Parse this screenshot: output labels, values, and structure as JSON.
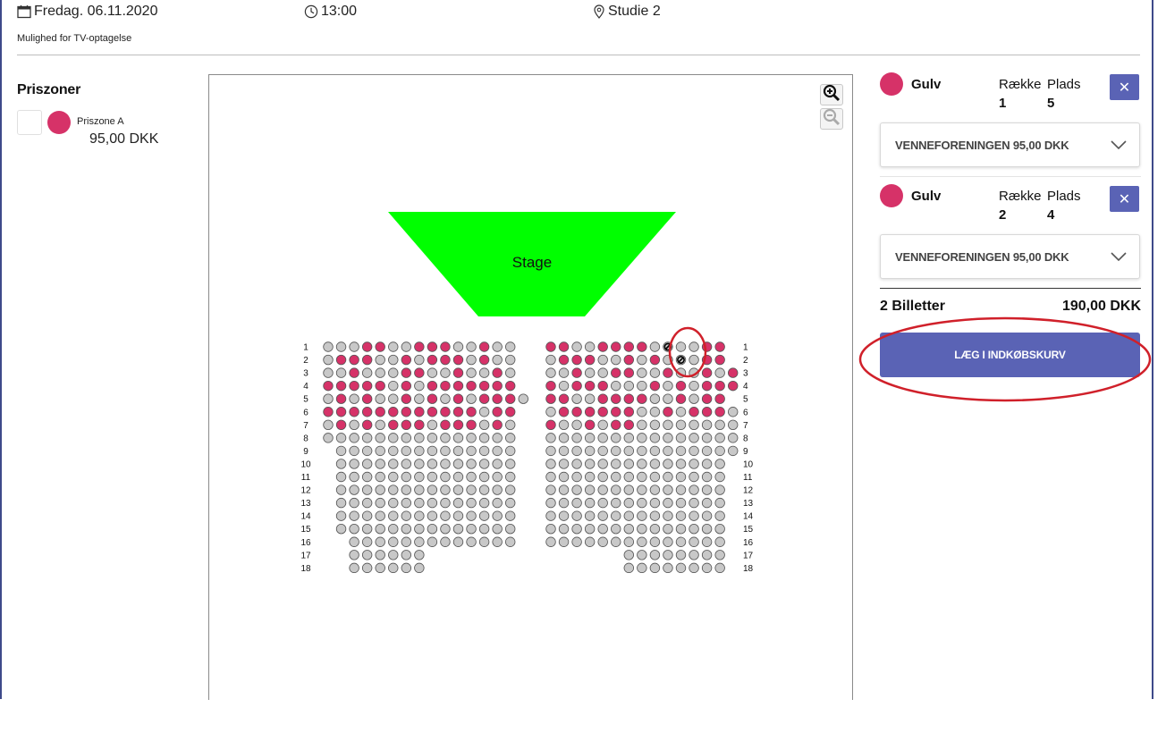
{
  "event": {
    "date": "Fredag. 06.11.2020",
    "time": "13:00",
    "venue": "Studie 2",
    "note": "Mulighed for TV-optagelse"
  },
  "icons": {
    "date": "calendar-icon",
    "time": "clock-icon",
    "venue": "location-pin-icon"
  },
  "pricezones": {
    "title": "Priszoner",
    "items": [
      {
        "name": "Priszone A",
        "price": "95,00 DKK",
        "color": "#d63268"
      }
    ]
  },
  "map": {
    "stage_label": "Stage",
    "zoom_in_icon": "zoom-in-icon",
    "zoom_out_icon": "zoom-out-icon",
    "colors": {
      "stage": "#00ff00",
      "seat_selected": "#d63268",
      "seat_free": "#c8c8c8",
      "seat_outline": "#555555"
    },
    "left_block": [
      {
        "row": "1",
        "seats": "ooossoosssoosoo"
      },
      {
        "row": "2",
        "seats": "osssoososssosoo"
      },
      {
        "row": "3",
        "seats": "oosooossoosooso"
      },
      {
        "row": "4",
        "seats": "sssssososssssss"
      },
      {
        "row": "5",
        "seats": "ososoosososossso"
      },
      {
        "row": "6",
        "seats": "ssssssssssssoss"
      },
      {
        "row": "7",
        "seats": "osososssosssoso"
      },
      {
        "row": "8",
        "seats": "ooooooooooooooo"
      },
      {
        "row": "9",
        "seats": "-oooooooooooooo"
      },
      {
        "row": "10",
        "seats": "-oooooooooooooo"
      },
      {
        "row": "11",
        "seats": "-oooooooooooooo"
      },
      {
        "row": "12",
        "seats": "-oooooooooooooo"
      },
      {
        "row": "13",
        "seats": "-oooooooooooooo"
      },
      {
        "row": "14",
        "seats": "-oooooooooooooo"
      },
      {
        "row": "15",
        "seats": "-oooooooooooooo"
      },
      {
        "row": "16",
        "seats": "--ooooooooooooo"
      },
      {
        "row": "17",
        "seats": "--oooooo"
      },
      {
        "row": "18",
        "seats": "--oooooo"
      }
    ],
    "right_block": [
      {
        "row": "1",
        "seats": "ssoossssoxooss"
      },
      {
        "row": "2",
        "seats": "osssoososoxoss"
      },
      {
        "row": "3",
        "seats": "oosoossoosoosos"
      },
      {
        "row": "4",
        "seats": "sosssooosososss"
      },
      {
        "row": "5",
        "seats": "ssoossssoososs"
      },
      {
        "row": "6",
        "seats": "ossssssoosossso"
      },
      {
        "row": "7",
        "seats": "soosossoooooooo"
      },
      {
        "row": "8",
        "seats": "ooooooooooooooo"
      },
      {
        "row": "9",
        "seats": "ooooooooooooooo"
      },
      {
        "row": "10",
        "seats": "oooooooooooooo"
      },
      {
        "row": "11",
        "seats": "oooooooooooooo"
      },
      {
        "row": "12",
        "seats": "oooooooooooooo"
      },
      {
        "row": "13",
        "seats": "oooooooooooooo"
      },
      {
        "row": "14",
        "seats": "oooooooooooooo"
      },
      {
        "row": "15",
        "seats": "oooooooooooooo"
      },
      {
        "row": "16",
        "seats": "oooooooooooooo"
      },
      {
        "row": "17",
        "seats": "------oooooooo"
      },
      {
        "row": "18",
        "seats": "------oooooooo"
      }
    ]
  },
  "cart": {
    "items": [
      {
        "area": "Gulv",
        "row_label": "Række",
        "seat_label": "Plads",
        "row": "1",
        "seat": "5",
        "ticket_type": "VENNEFORENINGEN 95,00 DKK",
        "remove": "✕"
      },
      {
        "area": "Gulv",
        "row_label": "Række",
        "seat_label": "Plads",
        "row": "2",
        "seat": "4",
        "ticket_type": "VENNEFORENINGEN 95,00 DKK",
        "remove": "✕"
      }
    ],
    "total_count": "2 Billetter",
    "total_sum": "190,00 DKK",
    "add_button": "LÆG I INDKØBSKURV"
  },
  "annotation_color": "#d0202a"
}
